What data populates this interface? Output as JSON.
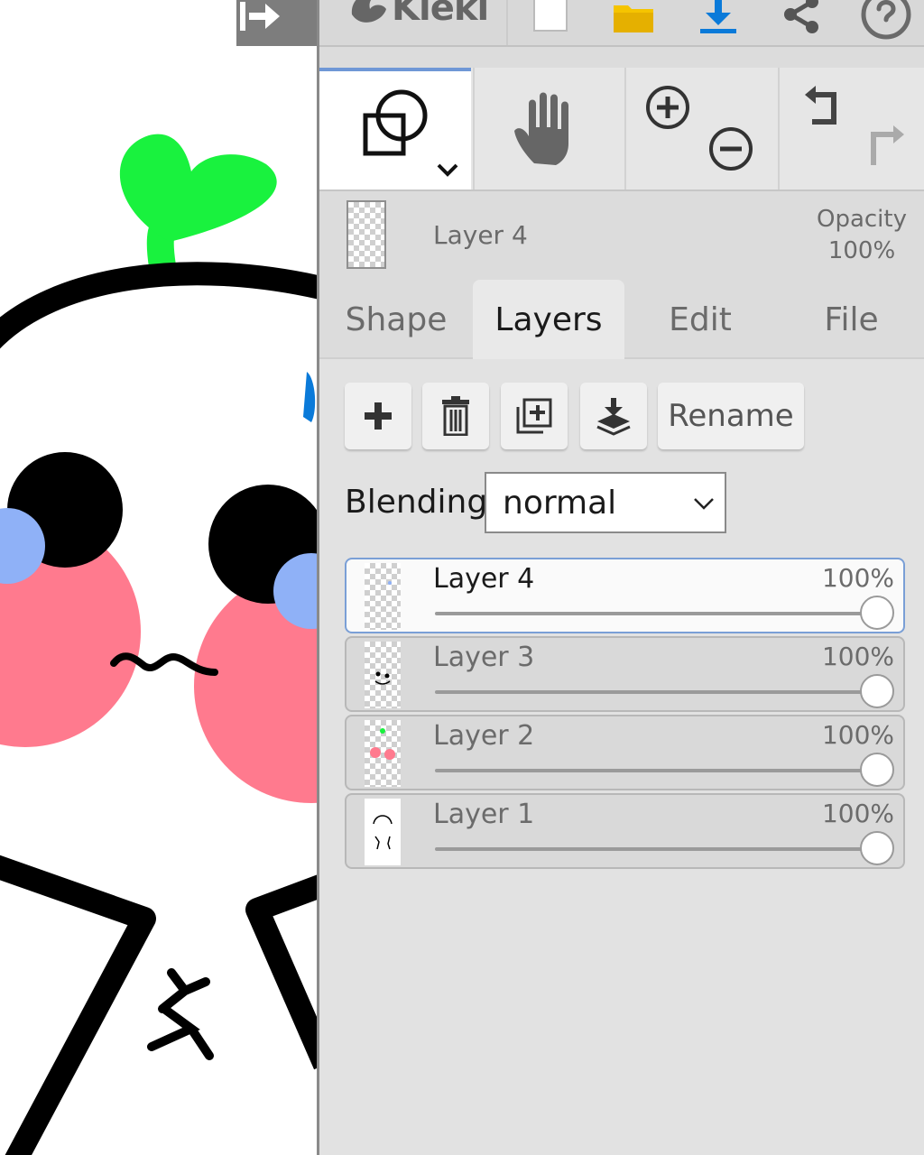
{
  "app": {
    "name": "Kleki"
  },
  "tools": {
    "active_tool": "shape-tool",
    "items": [
      "shape-tool",
      "hand-tool",
      "zoom-in",
      "zoom-out",
      "undo",
      "redo"
    ]
  },
  "current_layer": {
    "name": "Layer 4",
    "opacity_label": "Opacity",
    "opacity_value": "100%"
  },
  "tabs": [
    {
      "label": "Shape",
      "active": false
    },
    {
      "label": "Layers",
      "active": true
    },
    {
      "label": "Edit",
      "active": false
    },
    {
      "label": "File",
      "active": false
    }
  ],
  "layer_actions": {
    "rename_label": "Rename",
    "icons": [
      "plus-icon",
      "trash-icon",
      "duplicate-icon",
      "merge-down-icon"
    ]
  },
  "blending": {
    "label": "Blending",
    "value": "normal"
  },
  "layers": [
    {
      "name": "Layer 4",
      "opacity": "100%",
      "opacity_fraction": 1.0,
      "active": true
    },
    {
      "name": "Layer 3",
      "opacity": "100%",
      "opacity_fraction": 1.0,
      "active": false
    },
    {
      "name": "Layer 2",
      "opacity": "100%",
      "opacity_fraction": 1.0,
      "active": false
    },
    {
      "name": "Layer 1",
      "opacity": "100%",
      "opacity_fraction": 1.0,
      "active": false
    }
  ],
  "colors": {
    "accent": "#6f97d6",
    "panel_bg": "#dcdcdc",
    "sprout_green": "#19f23e",
    "cheek_pink": "#ff7a8e",
    "blush_blue": "#8fb1f7",
    "accent_blue": "#0a7ad9",
    "folder_yellow": "#f5c400"
  }
}
